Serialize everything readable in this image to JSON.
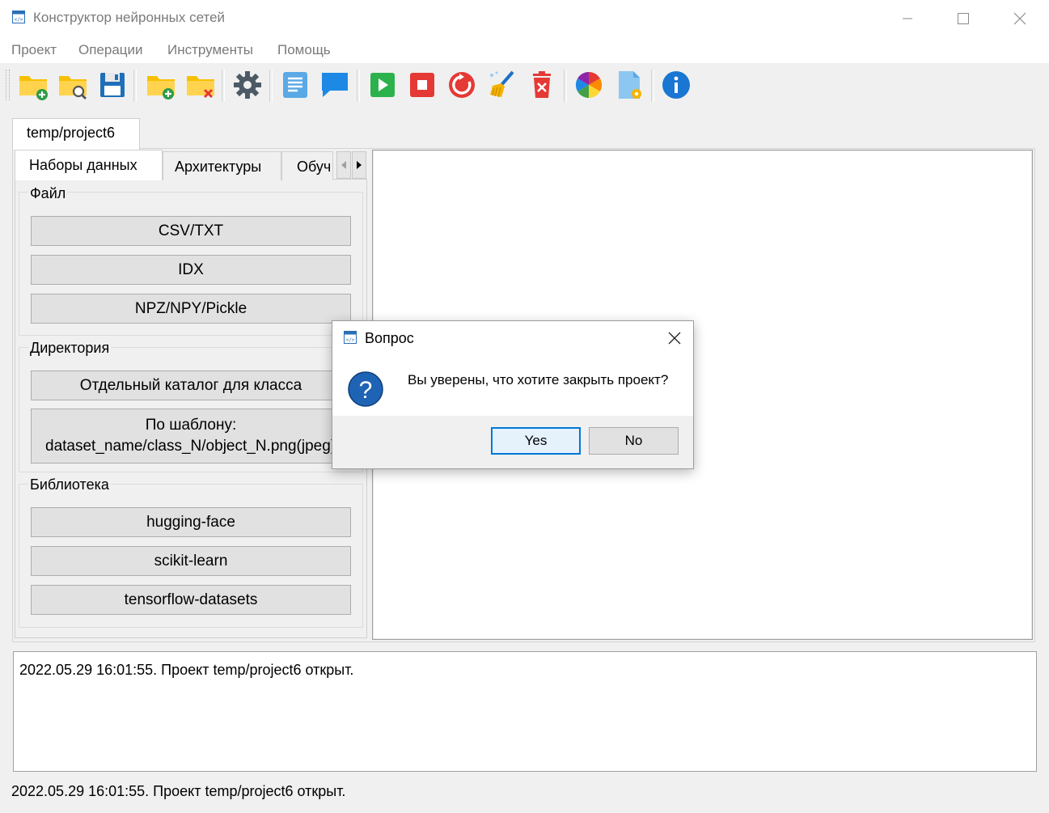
{
  "window": {
    "title": "Конструктор нейронных сетей"
  },
  "menu": [
    "Проект",
    "Операции",
    "Инструменты",
    "Помощь"
  ],
  "toolbar": [
    {
      "icon": "new-folder-add-icon"
    },
    {
      "icon": "folder-search-icon"
    },
    {
      "icon": "save-disk-icon"
    },
    {
      "icon": "folder-add-icon"
    },
    {
      "icon": "folder-delete-icon"
    },
    {
      "icon": "gear-icon"
    },
    {
      "icon": "text-document-icon"
    },
    {
      "icon": "chat-bubble-icon"
    },
    {
      "icon": "play-icon"
    },
    {
      "icon": "stop-icon"
    },
    {
      "icon": "restart-icon"
    },
    {
      "icon": "clean-broom-icon"
    },
    {
      "icon": "trash-delete-icon"
    },
    {
      "icon": "color-wheel-icon"
    },
    {
      "icon": "document-settings-icon"
    },
    {
      "icon": "info-icon"
    }
  ],
  "project_tab": "temp/project6",
  "inner_tabs": [
    "Наборы данных",
    "Архитектуры",
    "Обуч"
  ],
  "groups": {
    "file": {
      "title": "Файл",
      "buttons": [
        "CSV/TXT",
        "IDX",
        "NPZ/NPY/Pickle"
      ]
    },
    "directory": {
      "title": "Директория",
      "buttons": [
        "Отдельный каталог для класса",
        "По шаблону:",
        "dataset_name/class_N/object_N.png(jpeg)"
      ]
    },
    "library": {
      "title": "Библиотека",
      "buttons": [
        "hugging-face",
        "scikit-learn",
        "tensorflow-datasets"
      ]
    }
  },
  "log": "2022.05.29 16:01:55. Проект temp/project6 открыт.",
  "status": "2022.05.29 16:01:55. Проект temp/project6 открыт.",
  "dialog": {
    "title": "Вопрос",
    "message": "Вы уверены, что хотите закрыть проект?",
    "yes": "Yes",
    "no": "No"
  },
  "colors": {
    "accent": "#0078d7",
    "folder": "#f6c000",
    "play": "#2bb24c",
    "stop": "#e53935",
    "info": "#1976d2"
  }
}
